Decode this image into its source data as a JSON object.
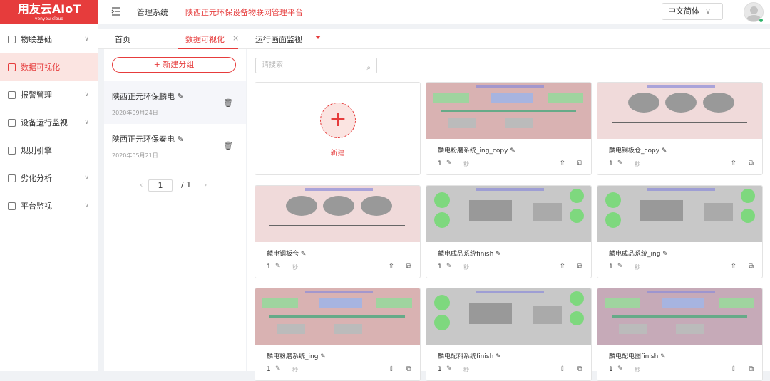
{
  "logo": {
    "main": "用友云AIoT",
    "sub": "yonyou cloud"
  },
  "header": {
    "brand": "管理系统",
    "platform": "陕西正元环保设备物联网管理平台",
    "language": "中文简体"
  },
  "sidebar": {
    "items": [
      {
        "label": "物联基础",
        "icon": "cube-icon",
        "expandable": true,
        "active": false
      },
      {
        "label": "数据可视化",
        "icon": "screen-icon",
        "expandable": false,
        "active": true
      },
      {
        "label": "报警管理",
        "icon": "alarm-icon",
        "expandable": true,
        "active": false
      },
      {
        "label": "设备运行监视",
        "icon": "monitor-icon",
        "expandable": true,
        "active": false
      },
      {
        "label": "规则引擎",
        "icon": "rules-icon",
        "expandable": false,
        "active": false
      },
      {
        "label": "劣化分析",
        "icon": "analysis-icon",
        "expandable": true,
        "active": false
      },
      {
        "label": "平台监视",
        "icon": "platform-icon",
        "expandable": true,
        "active": false
      }
    ]
  },
  "tabs": [
    {
      "label": "首页",
      "active": false
    },
    {
      "label": "数据可视化",
      "active": true,
      "closable": true
    },
    {
      "label": "运行画面监视",
      "active": false
    }
  ],
  "groups": {
    "new_label": "+ 新建分组",
    "items": [
      {
        "name": "陕西正元环保麟电",
        "date": "2020年09月24日",
        "selected": true
      },
      {
        "name": "陕西正元环保秦电",
        "date": "2020年05月21日",
        "selected": false
      }
    ],
    "pager": {
      "current": "1",
      "total": "/ 1"
    }
  },
  "search": {
    "placeholder": "请搜索"
  },
  "new_card": {
    "label": "新建"
  },
  "cards": [
    {
      "name": "麟电粉磨系统_ing_copy",
      "count": "1",
      "unit": "秒",
      "style": "pink"
    },
    {
      "name": "麟电钢板仓_copy",
      "count": "1",
      "unit": "秒",
      "style": "lightpink"
    },
    {
      "name": "麟电钢板仓",
      "count": "1",
      "unit": "秒",
      "style": "lightpink"
    },
    {
      "name": "麟电成品系统finish",
      "count": "1",
      "unit": "秒",
      "style": "grey"
    },
    {
      "name": "麟电成品系统_ing",
      "count": "1",
      "unit": "秒",
      "style": "grey"
    },
    {
      "name": "麟电粉磨系统_ing",
      "count": "1",
      "unit": "秒",
      "style": "pink"
    },
    {
      "name": "麟电配料系统finish",
      "count": "1",
      "unit": "秒",
      "style": "grey"
    },
    {
      "name": "麟电配电图finish",
      "count": "1",
      "unit": "秒",
      "style": "mauve"
    }
  ],
  "colors": {
    "accent": "#e63c3c",
    "active_bg": "#fbe4e1"
  }
}
